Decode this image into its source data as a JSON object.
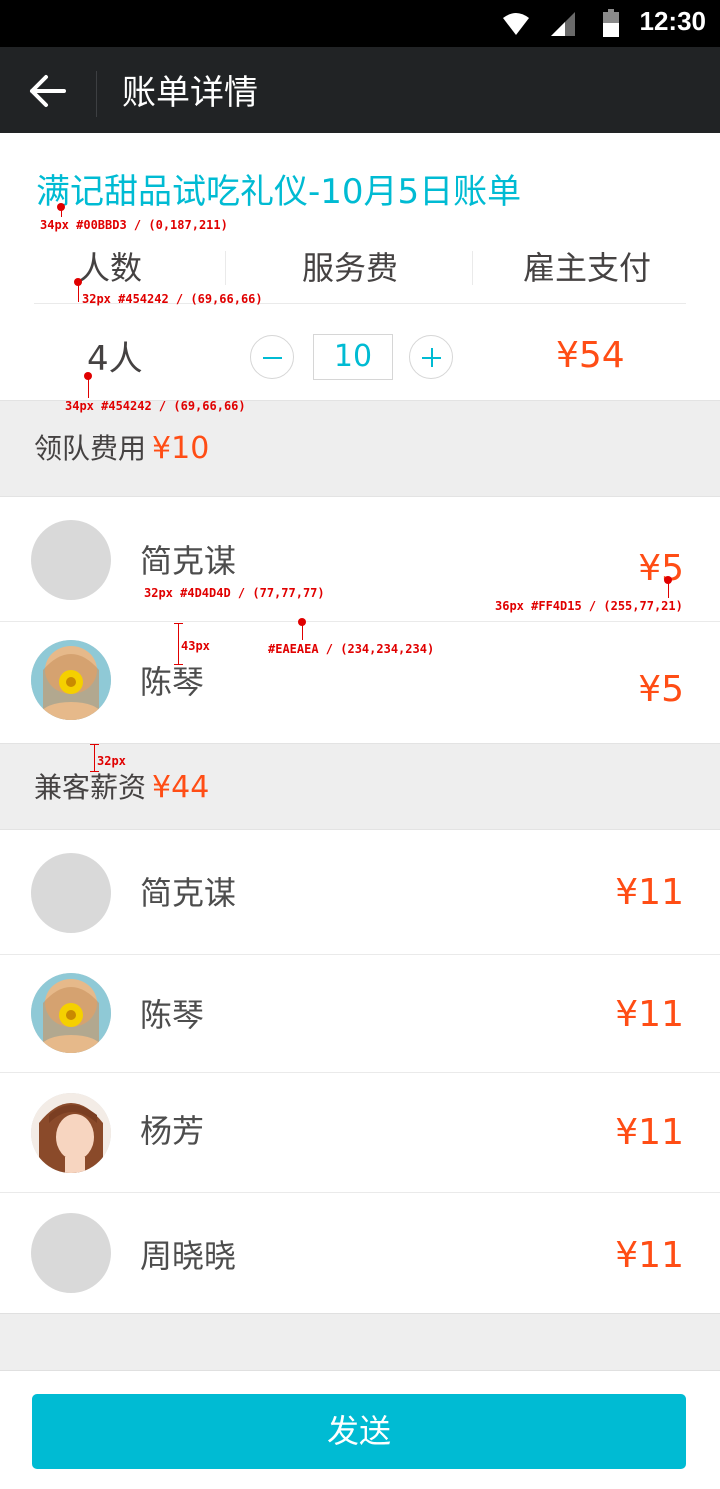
{
  "status_bar": {
    "time": "12:30"
  },
  "app_bar": {
    "title": "账单详情"
  },
  "bill": {
    "title": "满记甜品试吃礼仪-10月5日账单"
  },
  "columns": [
    "人数",
    "服务费",
    "雇主支付"
  ],
  "summary": {
    "people": "4人",
    "stepper_minus": "−",
    "stepper_value": "10",
    "stepper_plus": "+",
    "employer_pay": "¥54"
  },
  "leader_section": {
    "label": "领队费用",
    "amount": "¥10",
    "rows": [
      {
        "name": "简克谋",
        "amount": "¥5",
        "avatar": "placeholder"
      },
      {
        "name": "陈琴",
        "amount": "¥5",
        "avatar": "photo-sunflower"
      }
    ]
  },
  "parttime_section": {
    "label": "兼客薪资",
    "amount": "¥44",
    "rows": [
      {
        "name": "简克谋",
        "amount": "¥11",
        "avatar": "placeholder"
      },
      {
        "name": "陈琴",
        "amount": "¥11",
        "avatar": "photo-sunflower"
      },
      {
        "name": "杨芳",
        "amount": "¥11",
        "avatar": "photo-girl"
      },
      {
        "name": "周晓晓",
        "amount": "¥11",
        "avatar": "placeholder"
      }
    ]
  },
  "send_button": {
    "label": "发送"
  },
  "annotations": {
    "title_spec": "34px #00BBD3 / (0,187,211)",
    "column_spec": "32px #454242 / (69,66,66)",
    "people_spec": "34px #454242 / (69,66,66)",
    "name_spec": "32px #4D4D4D / (77,77,77)",
    "amount_spec": "36px #FF4D15 / (255,77,21)",
    "row_gap": "43px",
    "divider_spec": "#EAEAEA / (234,234,234)",
    "section_gap": "32px"
  },
  "colors": {
    "accent": "#00BBD3",
    "price": "#FF4D15",
    "text": "#454242",
    "name_text": "#4D4D4D",
    "divider": "#EAEAEA",
    "app_bar": "#212325"
  }
}
